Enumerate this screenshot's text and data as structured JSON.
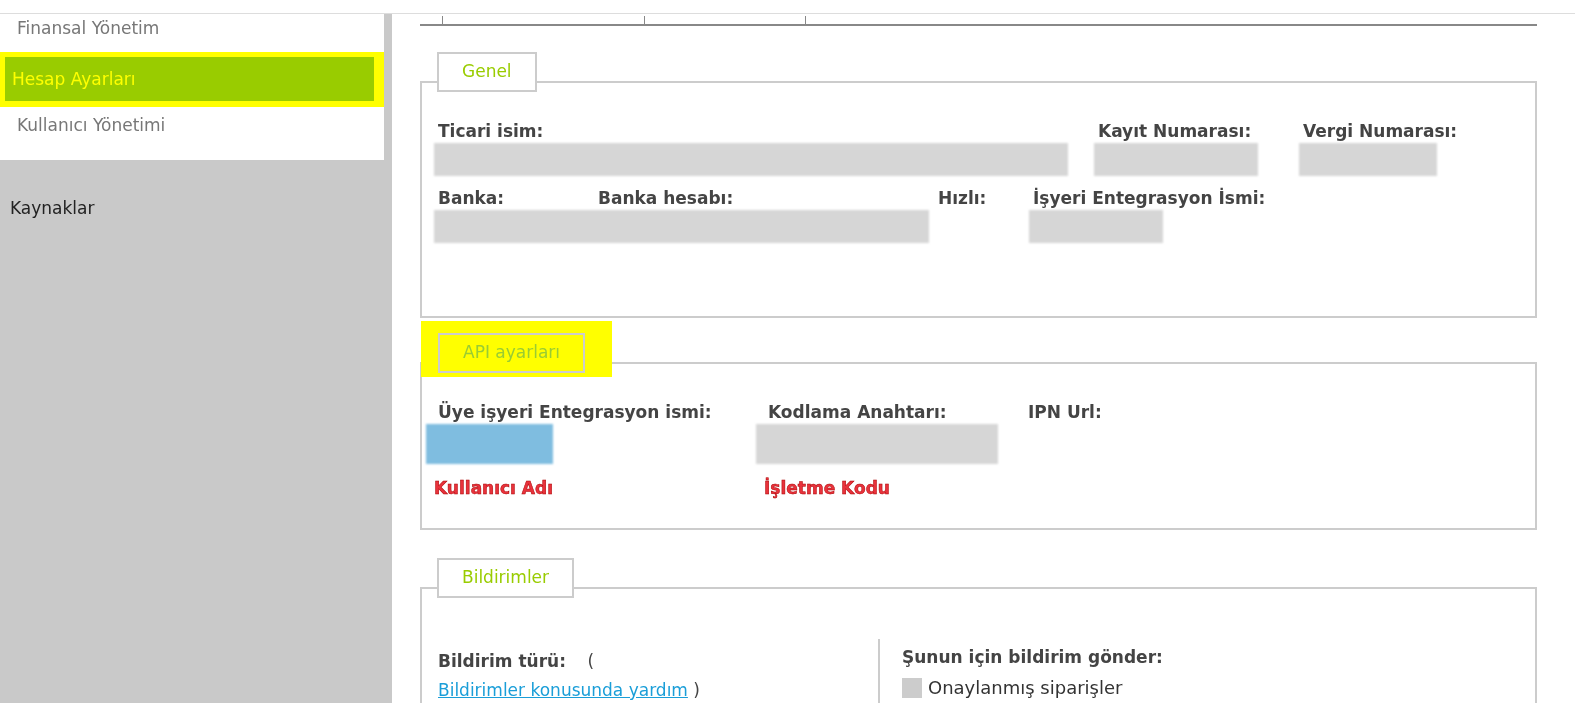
{
  "sidebar": {
    "items": [
      {
        "label": "Finansal Yönetim",
        "selected": false,
        "highlighted": false
      },
      {
        "label": "Hesap Ayarları",
        "selected": true,
        "highlighted": true
      },
      {
        "label": "Kullanıcı Yönetimi",
        "selected": false,
        "highlighted": false
      }
    ],
    "section": "Kaynaklar"
  },
  "sections": [
    {
      "legend": "Genel",
      "highlighted": false,
      "lines": [
        {
          "fields": [
            {
              "label": "Ticari isim:",
              "color": "#d6d6d6"
            },
            {
              "label": "Kayıt Numarası:",
              "color": "#d6d6d6"
            },
            {
              "label": "Vergi Numarası:",
              "color": "#d6d6d6"
            }
          ]
        },
        {
          "fields": [
            {
              "label": "Banka:",
              "color": "#d6d6d6"
            },
            {
              "label": "Banka hesabı:"
            },
            {
              "label": "Hızlı:"
            },
            {
              "label": "İşyeri Entegrasyon İsmi:",
              "color": "#d6d6d6"
            }
          ]
        }
      ]
    },
    {
      "legend": "API ayarları",
      "highlighted": true,
      "lines": [
        {
          "fields": [
            {
              "label": "Üye işyeri Entegrasyon ismi:",
              "color": "#7fbde0",
              "annotation": "Kullanıcı Adı"
            },
            {
              "label": "Kodlama Anahtarı:",
              "color": "#d6d6d6",
              "annotation": "İşletme Kodu"
            },
            {
              "label": "IPN Url:"
            }
          ]
        }
      ]
    },
    {
      "legend": "Bildirimler",
      "highlighted": false,
      "notifications": {
        "type_label": "Bildirim türü:",
        "help_open": "(",
        "help_link": "Bildirimler konusunda yardım",
        "help_close": ")",
        "send_label": "Şunun için bildirim gönder:",
        "options": [
          {
            "label": "Onaylanmış siparişler",
            "checked": false
          }
        ]
      }
    }
  ]
}
